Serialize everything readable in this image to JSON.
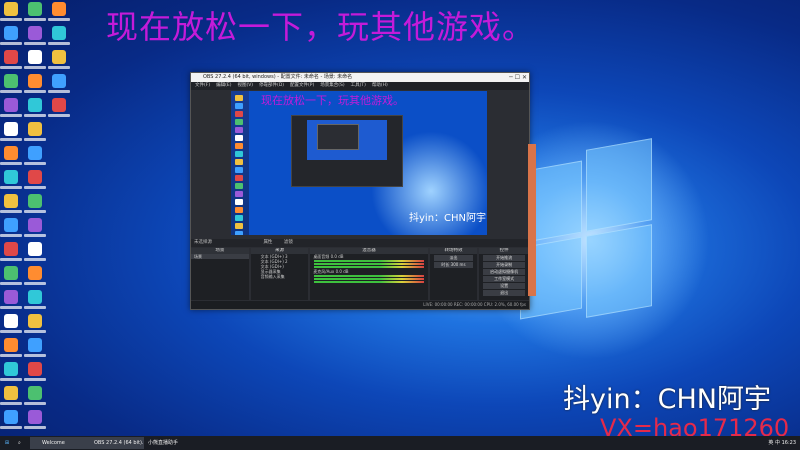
{
  "headline": "现在放松一下，玩其他游戏。",
  "brand": "抖yin：CHN阿宇",
  "contact": "VX=hao171260",
  "obs": {
    "title": "OBS 27.2.4 (64 bit, windows) - 配置文件: 未命名 - 场景: 未命名",
    "menu": [
      "文件(F)",
      "编辑(E)",
      "视图(V)",
      "停靠部件(D)",
      "配置文件(P)",
      "场景集合(S)",
      "工具(T)",
      "帮助(H)"
    ],
    "preview_headline": "现在放松一下，玩其他游戏。",
    "preview_brand": "抖yin：CHN阿宇",
    "source_bar": "未选择源",
    "source_bar_buttons": [
      "属性",
      "滤镜"
    ],
    "docks": {
      "scenes": {
        "title": "场景",
        "items": [
          "场景"
        ]
      },
      "sources": {
        "title": "来源",
        "items": [
          "文本 (GDI+) 3",
          "文本 (GDI+) 2",
          "文本 (GDI+)",
          "显示器采集",
          "音频输入采集"
        ]
      },
      "mixer": {
        "title": "混音器",
        "tracks": [
          "桌面音频",
          "麦克风/Aux"
        ],
        "levels": [
          "0.0 dB",
          "0.0 dB"
        ]
      },
      "transitions": {
        "title": "转场特效",
        "items": [
          "淡出",
          "时长 300 ms"
        ]
      },
      "controls": {
        "title": "控件",
        "buttons": [
          "开始推流",
          "开始录制",
          "启动虚拟摄像机",
          "工作室模式",
          "设置",
          "退出"
        ]
      }
    },
    "status": "LIVE: 00:00:00   REC: 00:00:00   CPU: 2.0%, 60.00 fps"
  },
  "taskbar": {
    "items": [
      "Welcome",
      "OBS 27.2.4 (64 bit)...",
      "小熊直播助手"
    ],
    "tray": "英 中  16:23"
  }
}
